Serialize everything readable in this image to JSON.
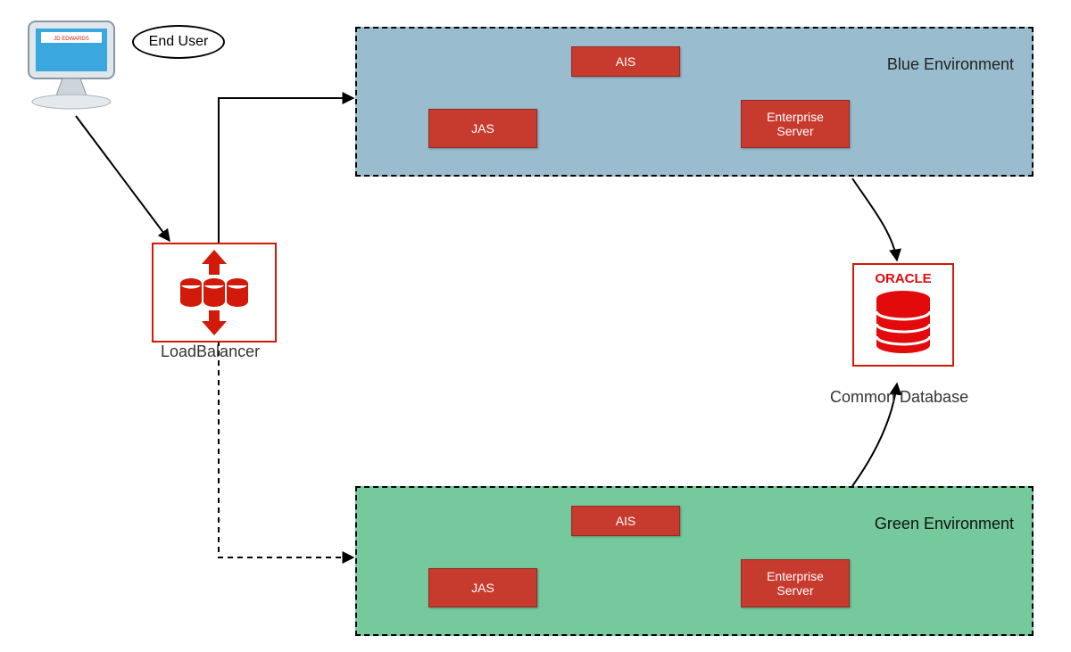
{
  "enduser": {
    "label": "End User"
  },
  "loadbalancer": {
    "label": "LoadBalancer"
  },
  "database": {
    "brand": "ORACLE",
    "label": "Common Database"
  },
  "blue_env": {
    "title": "Blue Environment",
    "jas": "JAS",
    "ais": "AIS",
    "es": "Enterprise\nServer"
  },
  "green_env": {
    "title": "Green Environment",
    "jas": "JAS",
    "ais": "AIS",
    "es": "Enterprise\nServer"
  }
}
